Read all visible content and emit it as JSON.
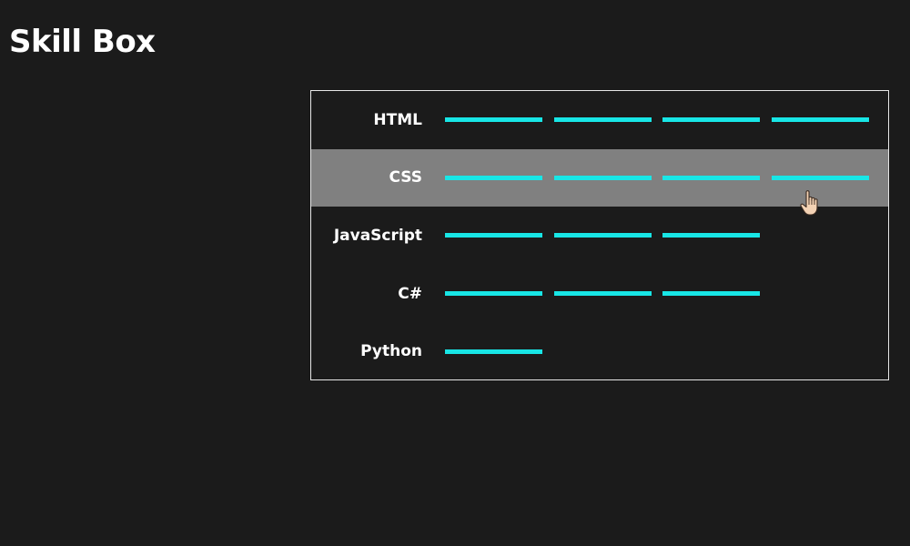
{
  "page": {
    "title": "Skill Box"
  },
  "colors": {
    "background": "#1b1b1b",
    "bar": "#18e6e6",
    "hover_row": "#808080",
    "border": "#e6e6e6"
  },
  "skills": [
    {
      "name": "HTML",
      "level": 4,
      "max": 4
    },
    {
      "name": "CSS",
      "level": 4,
      "max": 4,
      "hovered": true
    },
    {
      "name": "JavaScript",
      "level": 3,
      "max": 4
    },
    {
      "name": "C#",
      "level": 3,
      "max": 4
    },
    {
      "name": "Python",
      "level": 1,
      "max": 4
    }
  ],
  "cursor": {
    "icon": "hand-pointer-icon"
  }
}
